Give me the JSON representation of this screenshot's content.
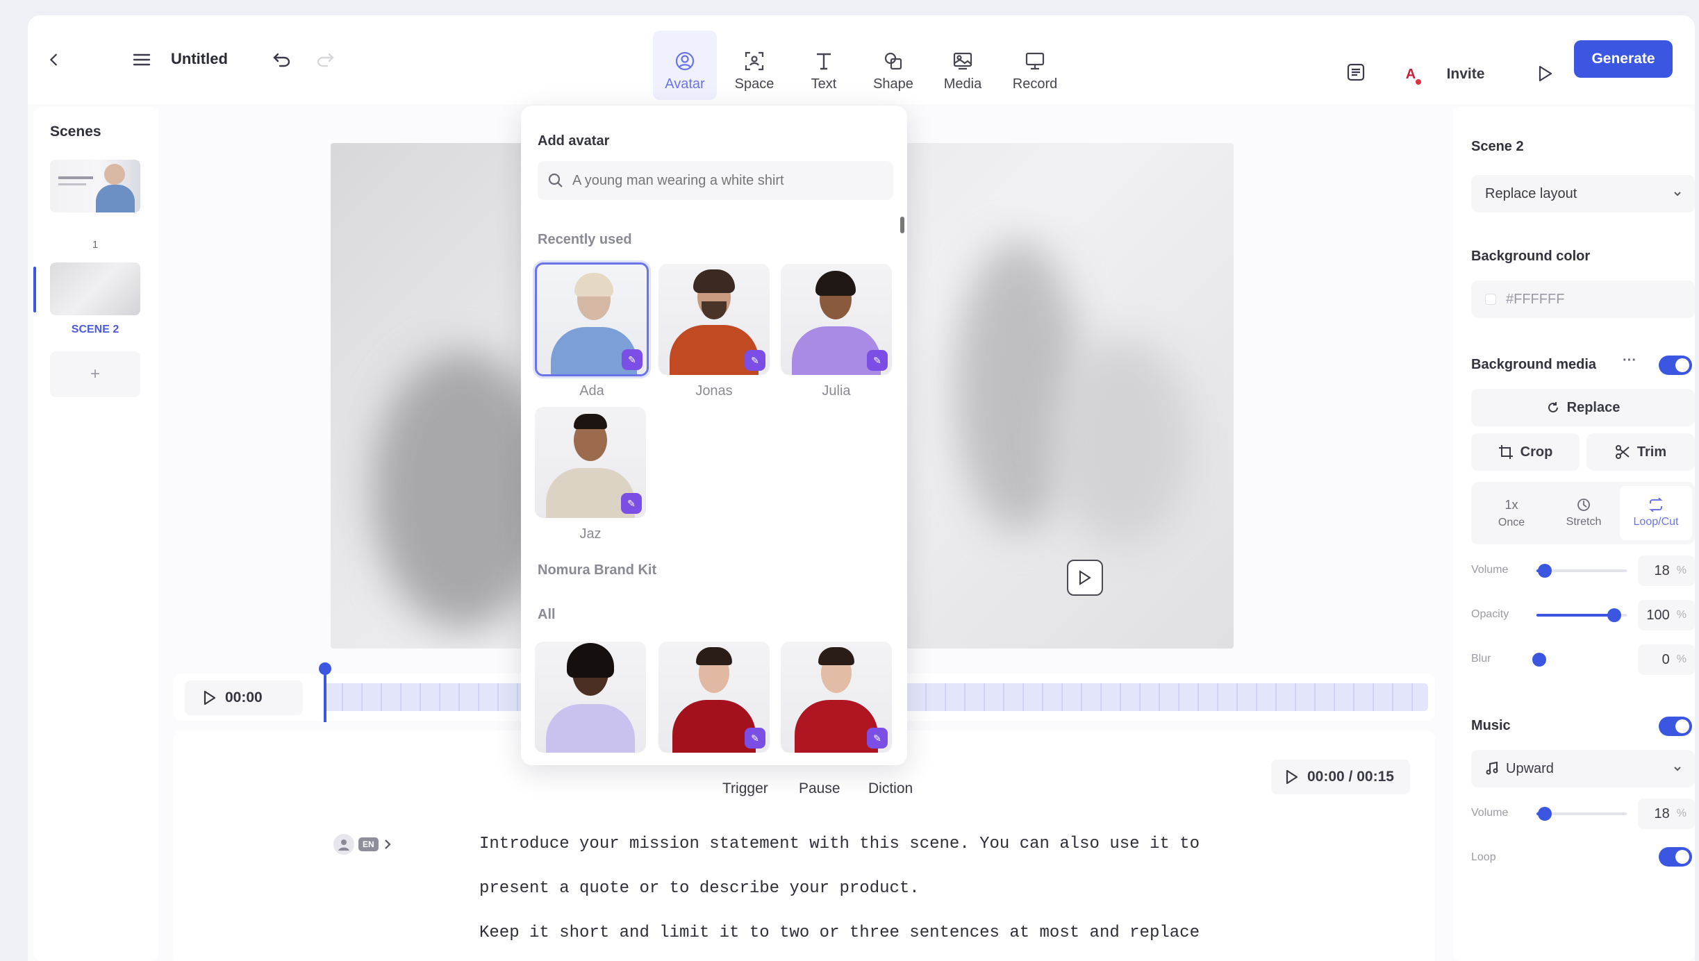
{
  "topbar": {
    "title": "Untitled",
    "tools": [
      {
        "label": "Avatar",
        "icon": "avatar-icon",
        "active": true
      },
      {
        "label": "Space",
        "icon": "space-icon"
      },
      {
        "label": "Text",
        "icon": "text-icon"
      },
      {
        "label": "Shape",
        "icon": "shape-icon"
      },
      {
        "label": "Media",
        "icon": "media-icon"
      },
      {
        "label": "Record",
        "icon": "record-icon"
      }
    ],
    "user_initial": "A",
    "invite_label": "Invite",
    "generate_label": "Generate"
  },
  "scenes": {
    "heading": "Scenes",
    "items": [
      {
        "label": "1"
      },
      {
        "label": "SCENE 2",
        "active": true
      }
    ],
    "add_label": "+"
  },
  "timeline": {
    "current_time": "00:00"
  },
  "avatar_popover": {
    "title": "Add avatar",
    "search_placeholder": "A young man wearing a white shirt",
    "recently_used_label": "Recently used",
    "recent": [
      {
        "name": "Ada",
        "selected": true
      },
      {
        "name": "Jonas"
      },
      {
        "name": "Julia"
      },
      {
        "name": "Jaz"
      }
    ],
    "brand_kit_label": "Nomura Brand Kit",
    "all_label": "All"
  },
  "editor": {
    "controls": [
      "Trigger",
      "Pause",
      "Diction"
    ],
    "time_display": "00:00 / 00:15",
    "language_badge": "EN",
    "lines": [
      "Introduce your mission statement with this scene. You can also use it to",
      "present a quote or to describe your product.",
      "Keep it short and limit it to two or three sentences at most and replace"
    ]
  },
  "panel": {
    "scene_title": "Scene 2",
    "layout_select": "Replace layout",
    "bg_color_label": "Background color",
    "bg_color_value": "#FFFFFF",
    "bg_media_label": "Background media",
    "more_label": "···",
    "replace_label": "Replace",
    "crop_label": "Crop",
    "trim_label": "Trim",
    "playback": [
      {
        "label": "Once",
        "glyph": "1x"
      },
      {
        "label": "Stretch"
      },
      {
        "label": "Loop/Cut",
        "active": true
      }
    ],
    "volume_label": "Volume",
    "volume_value": "18",
    "opacity_label": "Opacity",
    "opacity_value": "100",
    "blur_label": "Blur",
    "blur_value": "0",
    "pct": "%",
    "music_label": "Music",
    "music_track": "Upward",
    "music_volume_label": "Volume",
    "music_volume_value": "18",
    "loop_label": "Loop"
  },
  "colors": {
    "accent": "#3b56e0",
    "avatar_badge": "#7b4fe6",
    "active_tool_bg": "#f0f1ff"
  }
}
